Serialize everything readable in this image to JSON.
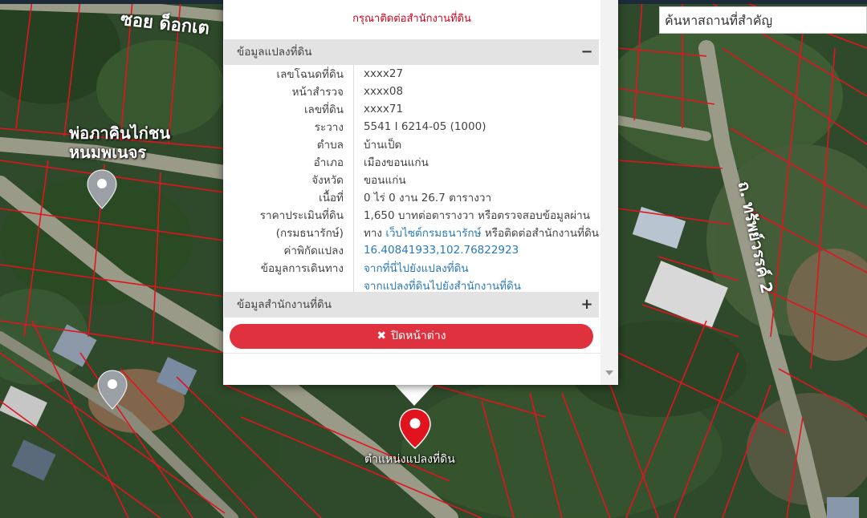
{
  "map": {
    "place_label": [
      "พ่อภาคินไก่ชน",
      "หนมพเนจร"
    ],
    "road_top": "ซอย ด็อกเต",
    "road_right": "ถ. ทรัพย์วรรค์ 2",
    "marker_label": "ตำแหน่งแปลงที่ดิน",
    "accent_color": "#e0313f"
  },
  "search": {
    "placeholder": "ค้นหาสถานที่สำคัญ"
  },
  "popup": {
    "notice": "กรุณาติดต่อสำนักงานที่ดิน",
    "section_parcel": {
      "title": "ข้อมูลแปลงที่ดิน",
      "toggle": "−"
    },
    "rows": [
      {
        "label": "เลขโฉนดที่ดิน",
        "value": "xxxx27"
      },
      {
        "label": "หน้าสำรวจ",
        "value": "xxxx08"
      },
      {
        "label": "เลขที่ดิน",
        "value": "xxxx71"
      },
      {
        "label": "ระวาง",
        "value": "5541 I 6214-05 (1000)"
      },
      {
        "label": "ตำบล",
        "value": "บ้านเป็ด"
      },
      {
        "label": "อำเภอ",
        "value": "เมืองขอนแก่น"
      },
      {
        "label": "จังหวัด",
        "value": "ขอนแก่น"
      },
      {
        "label": "เนื้อที่",
        "value": "0 ไร่ 0 งาน 26.7 ตารางวา"
      }
    ],
    "price": {
      "label1": "ราคาประเมินที่ดิน",
      "label2": "(กรมธนารักษ์)",
      "value1": "1,650 บาทต่อตารางวา หรือตรวจสอบข้อมูลผ่าน",
      "value2_pre": "ทาง",
      "value2_link": "เว็บไซต์กรมธนารักษ์",
      "value2_post": "หรือติดต่อสำนักงานที่ดิน"
    },
    "coords": {
      "label": "ค่าพิกัดแปลง",
      "value": "16.40841933,102.76822923"
    },
    "travel": {
      "label": "ข้อมูลการเดินทาง",
      "link1": "จากที่นี่ไปยังแปลงที่ดิน",
      "link2": "จากแปลงที่ดินไปยังสำนักงานที่ดิน"
    },
    "section_office": {
      "title": "ข้อมูลสำนักงานที่ดิน",
      "toggle": "+"
    },
    "close_icon": "✖",
    "close_label": "ปิดหน้าต่าง"
  }
}
